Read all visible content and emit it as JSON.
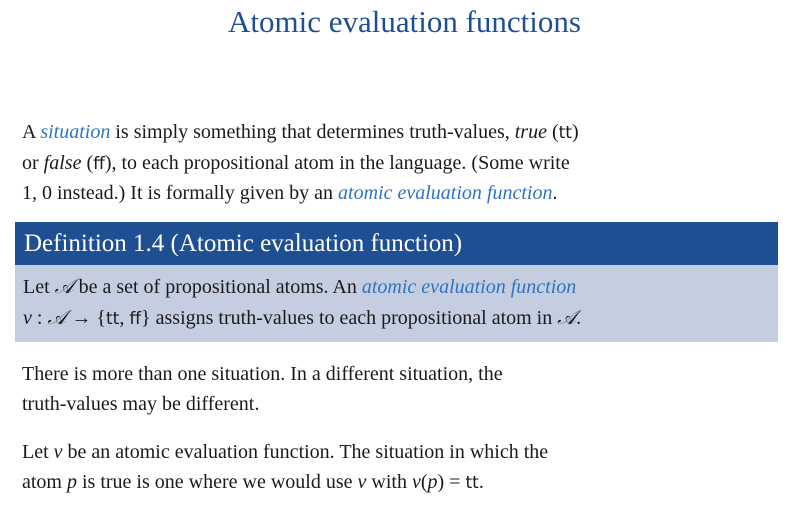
{
  "title": "Atomic evaluation functions",
  "intro": {
    "t1": "A ",
    "term_situation": "situation",
    "t2": " is simply something that determines truth-values, ",
    "true_word": "true",
    "t3": " (",
    "tt": "tt",
    "t4": ")",
    "t5": "or ",
    "false_word": "false",
    "t6": " (",
    "ff": "ff",
    "t7": "), to each propositional atom in the language. (Some write",
    "t8": "1, 0 instead.) It is formally given by an ",
    "term_aef": "atomic evaluation function",
    "t9": "."
  },
  "definition": {
    "heading": "Definition 1.4 (Atomic evaluation function)",
    "b1": "Let ",
    "calA": "𝒜",
    "b2": " be a set of propositional atoms. An ",
    "term_aef": "atomic evaluation function",
    "v": "v",
    "b3": " : ",
    "calA2": "𝒜",
    "b4": " → {",
    "tt": "tt",
    "b5": ", ",
    "ff": "ff",
    "b6": "} assigns truth-values to each propositional atom in ",
    "calA3": "𝒜",
    "b7": "."
  },
  "para2": {
    "line1": "There is more than one situation. In a different situation, the",
    "line2": "truth-values may be different."
  },
  "para3": {
    "t1": "Let ",
    "v": "v",
    "t2": " be an atomic evaluation function. The situation in which the",
    "t3": "atom ",
    "p": "p",
    "t4": " is true is one where we would use ",
    "v2": "v",
    "t5": " with ",
    "v3": "v",
    "t6": "(",
    "p2": "p",
    "t7": ") = ",
    "tt": "tt",
    "t8": "."
  }
}
